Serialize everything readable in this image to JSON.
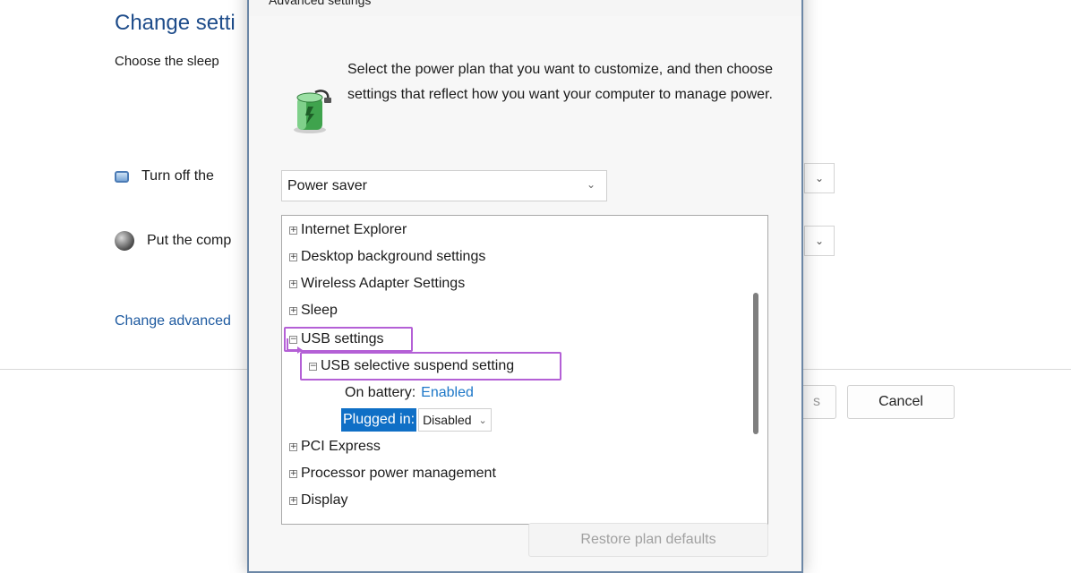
{
  "background_window": {
    "title": "Change setti",
    "subtitle": "Choose the sleep",
    "display_row_label": "Turn off the",
    "sleep_row_label": "Put the comp",
    "advanced_link": "Change advanced",
    "save_button_partial": "s",
    "cancel_button": "Cancel"
  },
  "dialog": {
    "title": "Advanced settings",
    "intro_text": "Select the power plan that you want to customize, and then choose settings that reflect how you want your computer to manage power.",
    "plan_select_value": "Power saver",
    "tree": {
      "items": [
        {
          "label": "Internet Explorer",
          "expander": "+"
        },
        {
          "label": "Desktop background settings",
          "expander": "+"
        },
        {
          "label": "Wireless Adapter Settings",
          "expander": "+"
        },
        {
          "label": "Sleep",
          "expander": "+"
        },
        {
          "label": "USB settings",
          "expander": "−"
        },
        {
          "label": "USB selective suspend setting",
          "expander": "−"
        },
        {
          "label": "PCI Express",
          "expander": "+"
        },
        {
          "label": "Processor power management",
          "expander": "+"
        },
        {
          "label": "Display",
          "expander": "+"
        }
      ],
      "on_battery_label": "On battery:",
      "on_battery_value": "Enabled",
      "plugged_in_label": "Plugged in:",
      "plugged_in_value": "Disabled"
    },
    "restore_button": "Restore plan defaults"
  },
  "colors": {
    "accent_link": "#1e78c8",
    "highlight_outline": "#b460d6",
    "selection_bg": "#0f6fc6"
  }
}
